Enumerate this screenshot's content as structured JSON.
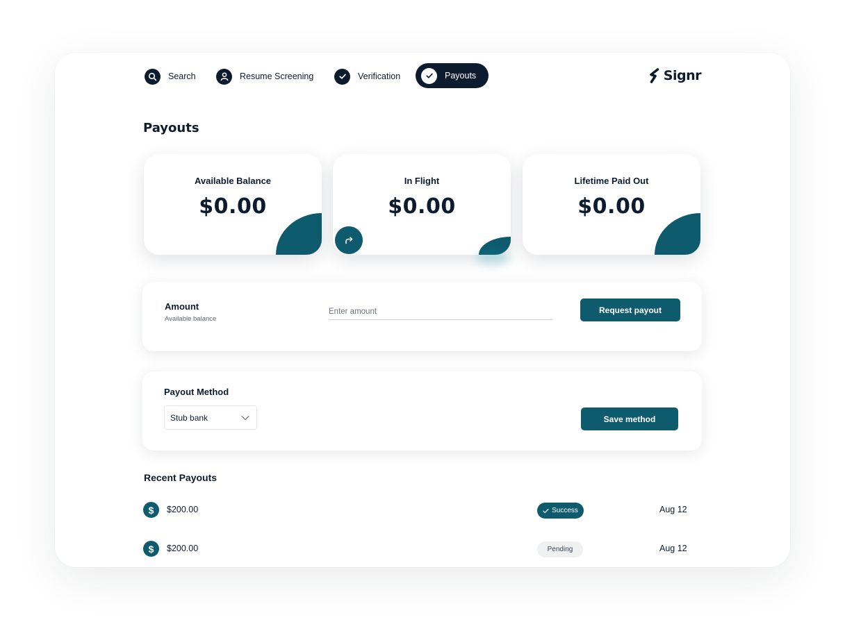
{
  "nav": {
    "items": [
      {
        "label": "Search",
        "icon": "search-icon"
      },
      {
        "label": "Resume Screening",
        "icon": "user-icon"
      },
      {
        "label": "Verification",
        "icon": "check-icon"
      },
      {
        "label": "Payouts",
        "icon": "check-icon",
        "active": true
      }
    ],
    "logo": "Signr"
  },
  "page": {
    "title": "Payouts"
  },
  "stats": [
    {
      "label": "Available Balance",
      "value": "$0.00"
    },
    {
      "label": "In Flight",
      "value": "$0.00"
    },
    {
      "label": "Lifetime Paid Out",
      "value": "$0.00"
    }
  ],
  "amount": {
    "label": "Amount",
    "sublabel": "Available balance",
    "placeholder": "Enter amount",
    "button": "Request payout"
  },
  "method": {
    "label": "Payout Method",
    "selected": "Stub bank",
    "button": "Save method"
  },
  "recent": {
    "title": "Recent Payouts",
    "rows": [
      {
        "amount": "$200.00",
        "status": "Success",
        "date": "Aug 12"
      },
      {
        "amount": "$200.00",
        "status": "Pending",
        "date": "Aug 12"
      }
    ]
  },
  "colors": {
    "navy": "#0d1b2e",
    "teal": "#0e5b6e",
    "pending_bg": "#eef0f2"
  }
}
